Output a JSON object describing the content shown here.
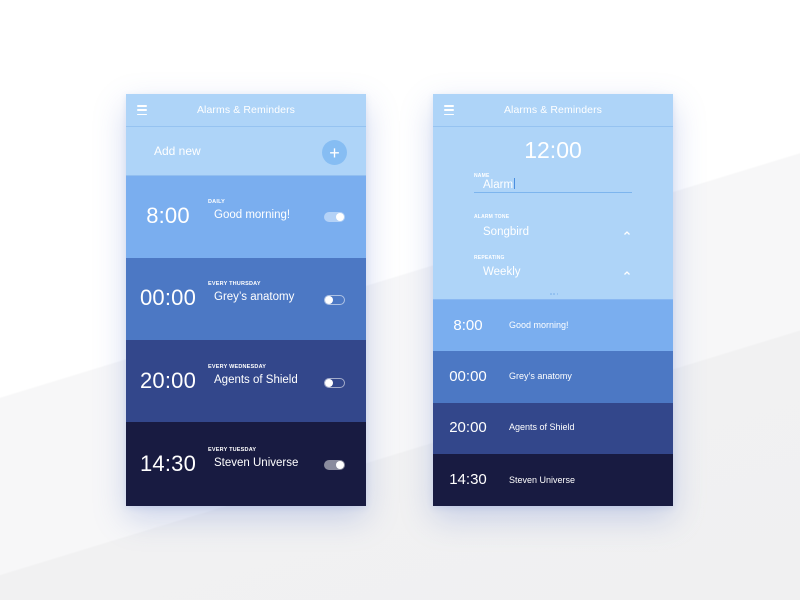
{
  "colors": {
    "header": "#aed4f8",
    "row_1": "#7aaeef",
    "row_2": "#4c78c4",
    "row_3": "#33478b",
    "row_4": "#181b41",
    "add_button": "#86bdf3"
  },
  "left_screen": {
    "header": {
      "menu_icon": "hamburger-menu-icon",
      "title": "Alarms & Reminders"
    },
    "add_new": {
      "label": "Add new",
      "button_icon": "+"
    },
    "alarms": [
      {
        "time": "8:00",
        "repeat": "DAILY",
        "name": "Good morning!",
        "enabled": true
      },
      {
        "time": "00:00",
        "repeat": "EVERY THURSDAY",
        "name": "Grey’s anatomy",
        "enabled": false
      },
      {
        "time": "20:00",
        "repeat": "EVERY WEDNESDAY",
        "name": "Agents of Shield",
        "enabled": false
      },
      {
        "time": "14:30",
        "repeat": "EVERY TUESDAY",
        "name": "Steven Universe",
        "enabled": true
      }
    ]
  },
  "right_screen": {
    "header": {
      "menu_icon": "hamburger-menu-icon",
      "title": "Alarms & Reminders"
    },
    "edit": {
      "time": "12:00",
      "name_label": "NAME",
      "name_value": "Alarm",
      "tone_label": "ALARM TONE",
      "tone_value": "Songbird",
      "repeat_label": "REPEATING",
      "repeat_value": "Weekly"
    },
    "alarms": [
      {
        "time": "8:00",
        "name": "Good morning!"
      },
      {
        "time": "00:00",
        "name": "Grey’s anatomy"
      },
      {
        "time": "20:00",
        "name": "Agents of Shield"
      },
      {
        "time": "14:30",
        "name": "Steven Universe"
      }
    ]
  }
}
